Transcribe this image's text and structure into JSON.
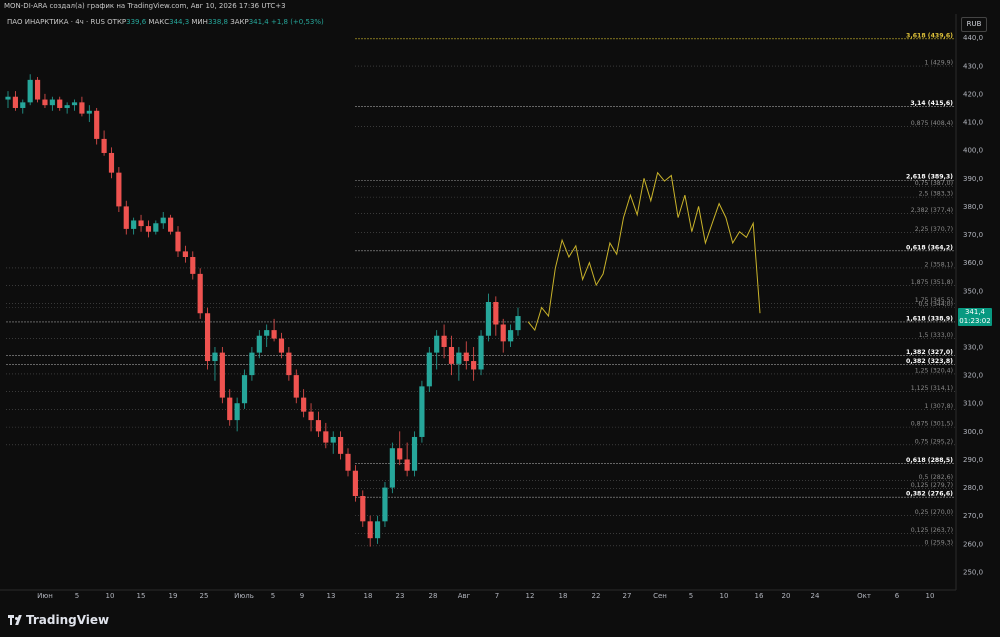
{
  "header": {
    "author_line": "MON-DI-ARA создал(а) график на TradingView.com, Авг 10, 2026 17:36 UTC+3"
  },
  "symbol_line": {
    "name": "ПАО ИНАРКТИКА · 4ч · RUS",
    "open_label": "ОТКР",
    "open_value": "339,6",
    "high_label": "МАКС",
    "high_value": "344,3",
    "low_label": "МИН",
    "low_value": "338,8",
    "close_label": "ЗАКР",
    "close_value": "341,4",
    "change": "+1,8 (+0,53%)"
  },
  "currency": "RUB",
  "last_price": {
    "value": "341,4",
    "countdown": "01:23:02"
  },
  "colors": {
    "up": "#26a69a",
    "down": "#ef5350",
    "projection": "#c9b32a",
    "background": "#0d0d0d",
    "price_tag": "#089981"
  },
  "y_axis_ticks": [
    "440,0",
    "430,0",
    "420,0",
    "410,0",
    "400,0",
    "390,0",
    "380,0",
    "370,0",
    "360,0",
    "350,0",
    "340,0",
    "330,0",
    "320,0",
    "310,0",
    "300,0",
    "290,0",
    "280,0",
    "270,0",
    "260,0",
    "250,0"
  ],
  "x_axis_ticks": [
    "Июн",
    "5",
    "10",
    "15",
    "19",
    "25",
    "Июль",
    "5",
    "9",
    "13",
    "18",
    "23",
    "28",
    "Авг",
    "7",
    "12",
    "18",
    "22",
    "27",
    "Сен",
    "5",
    "10",
    "16",
    "20",
    "24",
    "Окт",
    "6",
    "10"
  ],
  "fib_levels": [
    {
      "text": "3,618 (439,6)",
      "price": 439.6,
      "style": "yellow"
    },
    {
      "text": "1 (429,9)",
      "price": 429.9,
      "style": "grey"
    },
    {
      "text": "3,14 (415,6)",
      "price": 415.6,
      "style": "white"
    },
    {
      "text": "0,875 (408,4)",
      "price": 408.4,
      "style": "grey"
    },
    {
      "text": "2,618 (389,3)",
      "price": 389.3,
      "style": "white"
    },
    {
      "text": "0,75 (387,0)",
      "price": 387.0,
      "style": "grey"
    },
    {
      "text": "2,5 (383,3)",
      "price": 383.3,
      "style": "grey"
    },
    {
      "text": "2,382 (377,4)",
      "price": 377.4,
      "style": "grey"
    },
    {
      "text": "2,25 (370,7)",
      "price": 370.7,
      "style": "grey"
    },
    {
      "text": "0,618 (364,2)",
      "price": 364.2,
      "style": "white"
    },
    {
      "text": "2 (358,1)",
      "price": 358.1,
      "style": "grey"
    },
    {
      "text": "1,875 (351,8)",
      "price": 351.8,
      "style": "grey"
    },
    {
      "text": "1,75 (345,5)",
      "price": 345.5,
      "style": "grey"
    },
    {
      "text": "0,5 (344,0)",
      "price": 344.0,
      "style": "grey"
    },
    {
      "text": "1,618 (338,9)",
      "price": 338.9,
      "style": "white"
    },
    {
      "text": "1,5 (333,0)",
      "price": 333.0,
      "style": "grey"
    },
    {
      "text": "1,382 (327,0)",
      "price": 327.0,
      "style": "white"
    },
    {
      "text": "0,382 (323,8)",
      "price": 323.8,
      "style": "white"
    },
    {
      "text": "1,25 (320,4)",
      "price": 320.4,
      "style": "grey"
    },
    {
      "text": "1,125 (314,1)",
      "price": 314.1,
      "style": "grey"
    },
    {
      "text": "1 (307,8)",
      "price": 307.8,
      "style": "grey"
    },
    {
      "text": "0,875 (301,5)",
      "price": 301.5,
      "style": "grey"
    },
    {
      "text": "0,75 (295,2)",
      "price": 295.2,
      "style": "grey"
    },
    {
      "text": "0,618 (288,5)",
      "price": 288.5,
      "style": "white"
    },
    {
      "text": "0,5 (282,6)",
      "price": 282.6,
      "style": "grey"
    },
    {
      "text": "0,382 (276,6)",
      "price": 276.6,
      "style": "white"
    },
    {
      "text": "0,125 (279,7)",
      "price": 279.7,
      "style": "grey"
    },
    {
      "text": "0,25 (270,0)",
      "price": 270.0,
      "style": "grey"
    },
    {
      "text": "0,125 (263,7)",
      "price": 263.7,
      "style": "grey"
    },
    {
      "text": "0 (259,3)",
      "price": 259.3,
      "style": "grey"
    }
  ],
  "chart_data": {
    "type": "candlestick",
    "price_range": [
      245,
      447
    ],
    "price_axis_currency": "RUB",
    "projection_path": [
      [
        0,
        339
      ],
      [
        1,
        336
      ],
      [
        2,
        344
      ],
      [
        3,
        341
      ],
      [
        4,
        358
      ],
      [
        5,
        368
      ],
      [
        6,
        362
      ],
      [
        7,
        366
      ],
      [
        8,
        354
      ],
      [
        9,
        360
      ],
      [
        10,
        352
      ],
      [
        11,
        356
      ],
      [
        12,
        367
      ],
      [
        13,
        363
      ],
      [
        14,
        376
      ],
      [
        15,
        384
      ],
      [
        16,
        377
      ],
      [
        17,
        390
      ],
      [
        18,
        382
      ],
      [
        19,
        392
      ],
      [
        20,
        389
      ],
      [
        21,
        391
      ],
      [
        22,
        376
      ],
      [
        23,
        384
      ],
      [
        24,
        371
      ],
      [
        25,
        380
      ],
      [
        26,
        367
      ],
      [
        27,
        374
      ],
      [
        28,
        381
      ],
      [
        29,
        376
      ],
      [
        30,
        367
      ],
      [
        31,
        371
      ],
      [
        32,
        369
      ],
      [
        33,
        374
      ],
      [
        34,
        342
      ]
    ],
    "candles_ohlc": [
      [
        418,
        421,
        415,
        419
      ],
      [
        419,
        421,
        414,
        415
      ],
      [
        415,
        418,
        413,
        417
      ],
      [
        417,
        427,
        416,
        425
      ],
      [
        425,
        426,
        417,
        418
      ],
      [
        418,
        420,
        415,
        416
      ],
      [
        416,
        419,
        414,
        418
      ],
      [
        418,
        419,
        414,
        415
      ],
      [
        415,
        417,
        413,
        416
      ],
      [
        416,
        418,
        414,
        417
      ],
      [
        417,
        419,
        412,
        413
      ],
      [
        413,
        416,
        410,
        414
      ],
      [
        414,
        415,
        402,
        404
      ],
      [
        404,
        407,
        398,
        399
      ],
      [
        399,
        401,
        390,
        392
      ],
      [
        392,
        394,
        378,
        380
      ],
      [
        380,
        382,
        370,
        372
      ],
      [
        372,
        376,
        370,
        375
      ],
      [
        375,
        377,
        371,
        373
      ],
      [
        373,
        375,
        369,
        371
      ],
      [
        371,
        375,
        370,
        374
      ],
      [
        374,
        378,
        372,
        376
      ],
      [
        376,
        377,
        370,
        371
      ],
      [
        371,
        373,
        362,
        364
      ],
      [
        364,
        366,
        360,
        362
      ],
      [
        362,
        364,
        354,
        356
      ],
      [
        356,
        358,
        340,
        342
      ],
      [
        342,
        344,
        322,
        325
      ],
      [
        325,
        330,
        318,
        328
      ],
      [
        328,
        330,
        310,
        312
      ],
      [
        312,
        315,
        302,
        304
      ],
      [
        304,
        312,
        300,
        310
      ],
      [
        310,
        322,
        308,
        320
      ],
      [
        320,
        330,
        318,
        328
      ],
      [
        328,
        336,
        326,
        334
      ],
      [
        334,
        338,
        330,
        336
      ],
      [
        336,
        340,
        332,
        333
      ],
      [
        333,
        335,
        326,
        328
      ],
      [
        328,
        330,
        318,
        320
      ],
      [
        320,
        322,
        310,
        312
      ],
      [
        312,
        315,
        305,
        307
      ],
      [
        307,
        310,
        300,
        304
      ],
      [
        304,
        307,
        298,
        300
      ],
      [
        300,
        303,
        294,
        296
      ],
      [
        296,
        300,
        292,
        298
      ],
      [
        298,
        300,
        290,
        292
      ],
      [
        292,
        294,
        284,
        286
      ],
      [
        286,
        288,
        275,
        277
      ],
      [
        277,
        279,
        266,
        268
      ],
      [
        268,
        270,
        259,
        262
      ],
      [
        262,
        270,
        260,
        268
      ],
      [
        268,
        282,
        266,
        280
      ],
      [
        280,
        296,
        278,
        294
      ],
      [
        294,
        300,
        288,
        290
      ],
      [
        290,
        296,
        284,
        286
      ],
      [
        286,
        300,
        284,
        298
      ],
      [
        298,
        318,
        296,
        316
      ],
      [
        316,
        330,
        314,
        328
      ],
      [
        328,
        336,
        322,
        334
      ],
      [
        334,
        338,
        326,
        330
      ],
      [
        330,
        334,
        320,
        324
      ],
      [
        324,
        330,
        318,
        328
      ],
      [
        328,
        332,
        322,
        325
      ],
      [
        325,
        330,
        318,
        322
      ],
      [
        322,
        336,
        320,
        334
      ],
      [
        334,
        349,
        332,
        346
      ],
      [
        346,
        348,
        334,
        338
      ],
      [
        338,
        340,
        328,
        332
      ],
      [
        332,
        338,
        330,
        336
      ],
      [
        336,
        344,
        334,
        341
      ]
    ]
  }
}
